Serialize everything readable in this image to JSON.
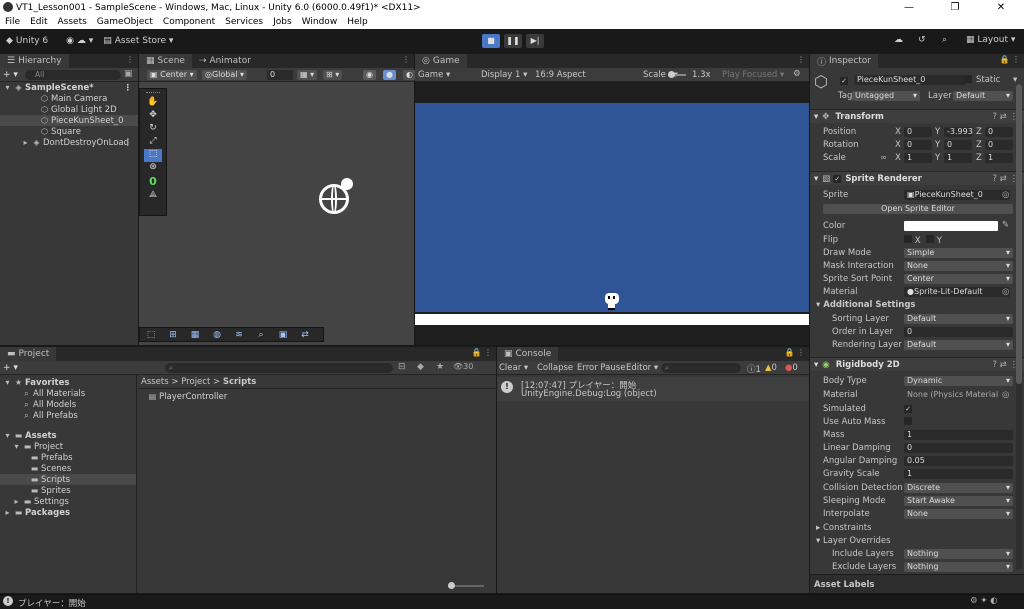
{
  "window": {
    "title": "VT1_Lesson001 - SampleScene - Windows, Mac, Linux - Unity 6.0 (6000.0.49f1)* <DX11>",
    "minimize": "—",
    "maximize": "❐",
    "close": "✕"
  },
  "menu": [
    "File",
    "Edit",
    "Assets",
    "GameObject",
    "Component",
    "Services",
    "Jobs",
    "Window",
    "Help"
  ],
  "toolbar": {
    "account": "Unity 6",
    "asset_store": "Asset Store",
    "layout": "Layout"
  },
  "hierarchy": {
    "tab": "Hierarchy",
    "search_placeholder": "All",
    "scene": "SampleScene*",
    "items": [
      "Main Camera",
      "Global Light 2D",
      "PieceKunSheet_0",
      "Square"
    ],
    "dontdestroy": "DontDestroyOnLoad"
  },
  "scene": {
    "tab_scene": "Scene",
    "tab_animator": "Animator",
    "pivot": "Center",
    "space": "Global",
    "snap_value": "0",
    "tool_counter": "0"
  },
  "game": {
    "tab": "Game",
    "mode": "Game",
    "display": "Display 1",
    "aspect": "16:9 Aspect",
    "scale_label": "Scale",
    "scale_value": "1.3x",
    "play_focused": "Play Focused",
    "bg_color": "#2f5597"
  },
  "project": {
    "tab": "Project",
    "favorites": "Favorites",
    "fav_items": [
      "All Materials",
      "All Models",
      "All Prefabs"
    ],
    "assets": "Assets",
    "project_folder": "Project",
    "folders": [
      "Prefabs",
      "Scenes",
      "Scripts",
      "Sprites"
    ],
    "settings": "Settings",
    "packages": "Packages",
    "breadcrumb": [
      "Assets",
      "Project",
      "Scripts"
    ],
    "files": [
      "PlayerController"
    ],
    "hidden_count": "30"
  },
  "console": {
    "tab": "Console",
    "clear": "Clear",
    "collapse": "Collapse",
    "error_pause": "Error Pause",
    "editor": "Editor",
    "count_info": "1",
    "count_warn": "0",
    "count_err": "0",
    "log_line1": "[12:07:47] プレイヤー：開始",
    "log_line2": "UnityEngine.Debug:Log (object)"
  },
  "inspector": {
    "tab": "Inspector",
    "object_name": "PieceKunSheet_0",
    "static": "Static",
    "tag_label": "Tag",
    "tag": "Untagged",
    "layer_label": "Layer",
    "layer": "Default",
    "transform": {
      "title": "Transform",
      "position": "Position",
      "rotation": "Rotation",
      "scale": "Scale",
      "pos": [
        "0",
        "-3.993",
        "0"
      ],
      "rot": [
        "0",
        "0",
        "0"
      ],
      "scl": [
        "1",
        "1",
        "1"
      ],
      "x": "X",
      "y": "Y",
      "z": "Z"
    },
    "sprite_renderer": {
      "title": "Sprite Renderer",
      "sprite_label": "Sprite",
      "sprite": "PieceKunSheet_0",
      "open_editor": "Open Sprite Editor",
      "color_label": "Color",
      "flip_label": "Flip",
      "flip_x": "X",
      "flip_y": "Y",
      "draw_mode_label": "Draw Mode",
      "draw_mode": "Simple",
      "mask_label": "Mask Interaction",
      "mask": "None",
      "sort_point_label": "Sprite Sort Point",
      "sort_point": "Center",
      "material_label": "Material",
      "material": "Sprite-Lit-Default",
      "additional": "Additional Settings",
      "sorting_layer_label": "Sorting Layer",
      "sorting_layer": "Default",
      "order_label": "Order in Layer",
      "order": "0",
      "rendering_layer_label": "Rendering Layer M",
      "rendering_layer": "Default"
    },
    "rigidbody": {
      "title": "Rigidbody 2D",
      "body_type_label": "Body Type",
      "body_type": "Dynamic",
      "material_label": "Material",
      "material": "None (Physics Material 2",
      "simulated_label": "Simulated",
      "auto_mass_label": "Use Auto Mass",
      "mass_label": "Mass",
      "mass": "1",
      "lin_damp_label": "Linear Damping",
      "lin_damp": "0",
      "ang_damp_label": "Angular Damping",
      "ang_damp": "0.05",
      "gravity_label": "Gravity Scale",
      "gravity": "1",
      "collision_label": "Collision Detection",
      "collision": "Discrete",
      "sleep_label": "Sleeping Mode",
      "sleep": "Start Awake",
      "interp_label": "Interpolate",
      "interp": "None",
      "constraints": "Constraints",
      "layer_overrides": "Layer Overrides",
      "include_label": "Include Layers",
      "include": "Nothing",
      "exclude_label": "Exclude Layers",
      "exclude": "Nothing"
    },
    "asset_labels": "Asset Labels"
  },
  "status": {
    "text": "プレイヤー：開始"
  }
}
